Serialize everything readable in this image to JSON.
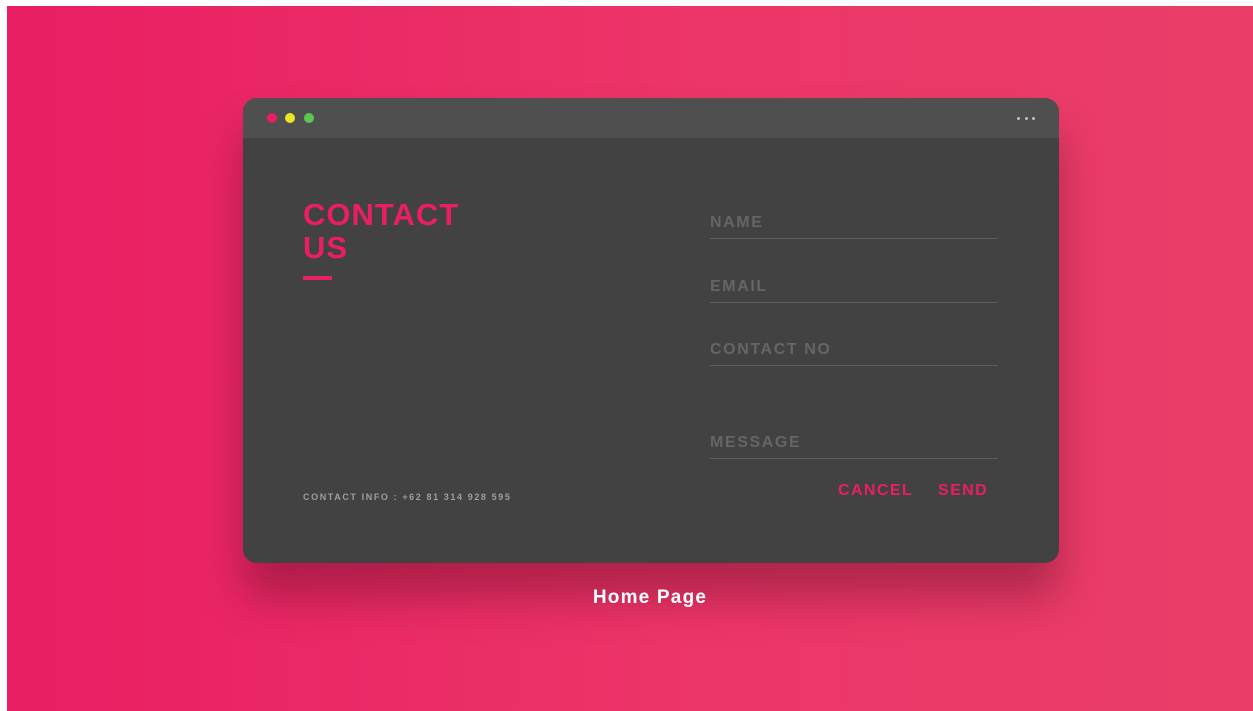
{
  "window": {
    "controls": [
      "close",
      "minimize",
      "maximize"
    ],
    "menu_icon": "more-horizontal-icon"
  },
  "contact": {
    "title_line1": "CONTACT",
    "title_line2": "US",
    "info": "CONTACT INFO : +62 81 314 928 595"
  },
  "form": {
    "name_placeholder": "NAME",
    "email_placeholder": "EMAIL",
    "phone_placeholder": "CONTACT NO",
    "message_placeholder": "MESSAGE",
    "cancel_label": "CANCEL",
    "send_label": "SEND"
  },
  "caption": "Home Page",
  "colors": {
    "accent": "#e91e63",
    "window_bg": "#424242",
    "titlebar_bg": "#4f4f4f",
    "dot_red": "#e91e63",
    "dot_yellow": "#e6e626",
    "dot_green": "#5cc84e"
  }
}
